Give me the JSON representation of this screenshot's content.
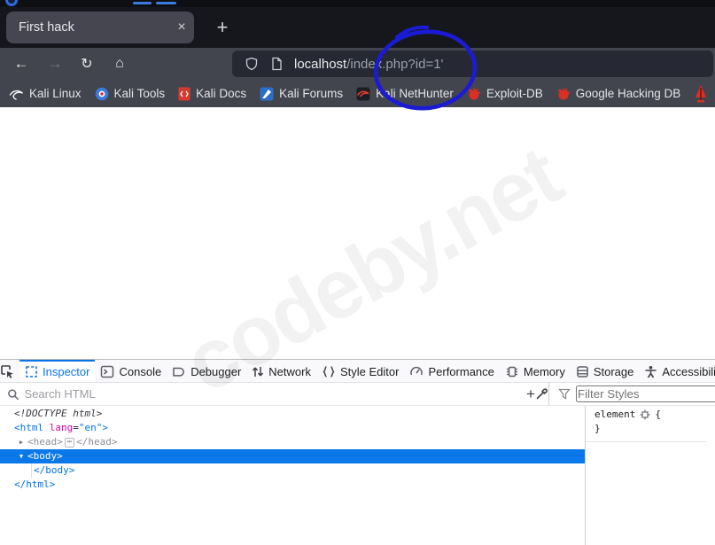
{
  "chrome": {
    "tab_title": "First hack",
    "close_glyph": "×",
    "new_tab_glyph": "+",
    "back_glyph": "←",
    "forward_glyph": "→",
    "reload_glyph": "↻",
    "home_glyph": "⌂",
    "url_host": "localhost",
    "url_path": "/index.php?id=1'"
  },
  "bookmarks": {
    "items": [
      {
        "label": "Kali Linux"
      },
      {
        "label": "Kali Tools"
      },
      {
        "label": "Kali Docs"
      },
      {
        "label": "Kali Forums"
      },
      {
        "label": "Kali NetHunter"
      },
      {
        "label": "Exploit-DB"
      },
      {
        "label": "Google Hacking DB"
      }
    ]
  },
  "page": {
    "watermark": "codeby.net"
  },
  "devtools": {
    "tabs": [
      {
        "label": "Inspector"
      },
      {
        "label": "Console"
      },
      {
        "label": "Debugger"
      },
      {
        "label": "Network"
      },
      {
        "label": "Style Editor"
      },
      {
        "label": "Performance"
      },
      {
        "label": "Memory"
      },
      {
        "label": "Storage"
      },
      {
        "label": "Accessibility"
      }
    ],
    "search_placeholder": "Search HTML",
    "filter_placeholder": "Filter Styles",
    "plus_glyph": "+",
    "markup": {
      "doctype": "<!DOCTYPE html>",
      "html_open": "<html",
      "attr_name": "lang",
      "eq": "=",
      "attr_value": "\"en\"",
      "gt": ">",
      "head_open": "<head>",
      "ellipsis": "⋯",
      "head_close": "</head>",
      "body_open": "<body>",
      "body_close": "</body>",
      "html_close": "</html>",
      "collapsed_arrow": "▶",
      "expanded_arrow": "▼"
    },
    "rules": {
      "selector": "element",
      "open_brace": "{",
      "close_brace": "}"
    }
  },
  "colors": {
    "accent_blue": "#0a74e8",
    "selection_blue": "#0a78e8",
    "annotation_blue": "#1b1bd6",
    "kali_red": "#d93025"
  }
}
